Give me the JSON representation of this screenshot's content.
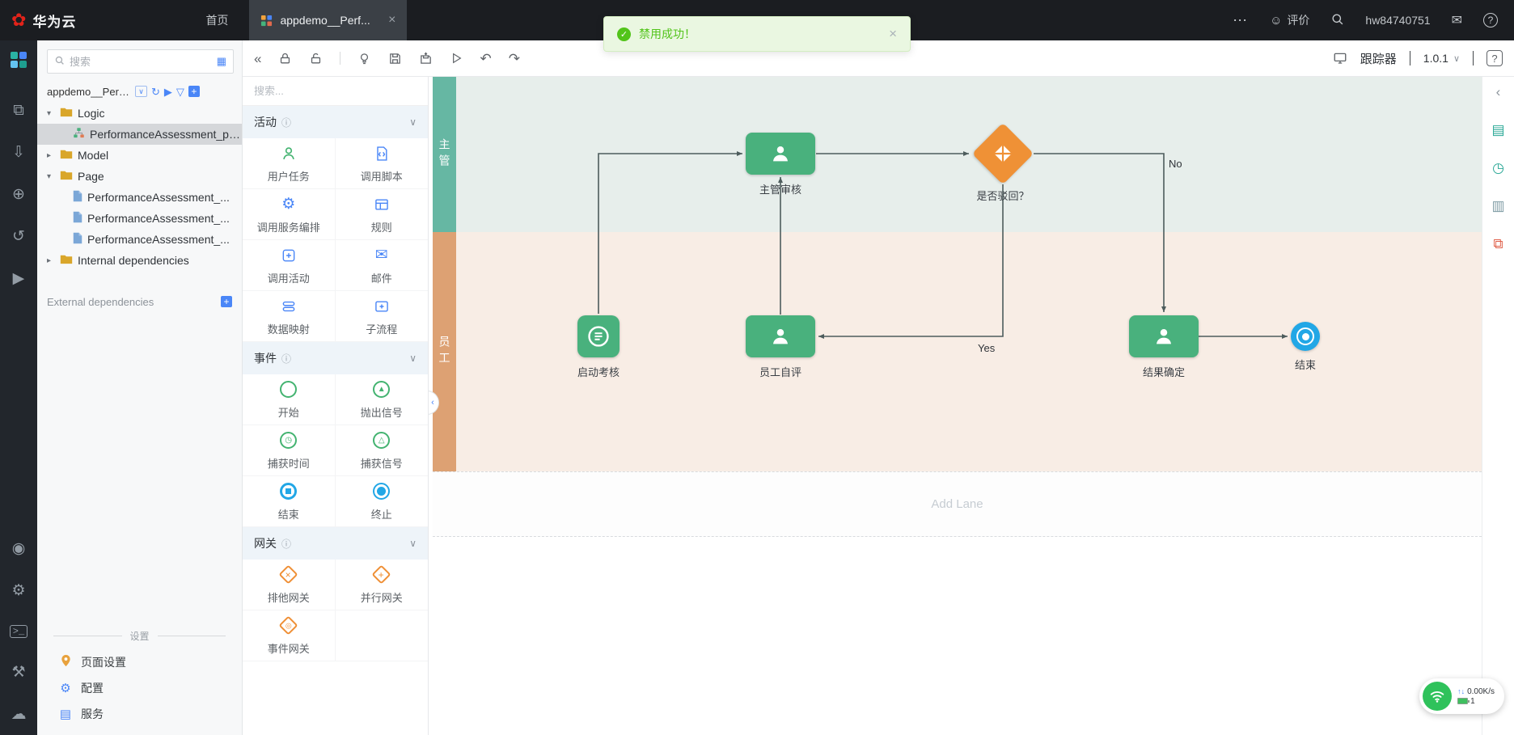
{
  "colors": {
    "node_green": "#49b17d",
    "gateway_orange": "#ef9136",
    "event_blue": "#22a7e6",
    "accent_blue": "#4a86f7",
    "toast_green": "#52c41a",
    "lane_supervisor": "#66b7a3",
    "lane_employee": "#dda173"
  },
  "topbar": {
    "brand": "华为云",
    "home_link": "首页",
    "tab_title": "appdemo__Perf...",
    "more": "⋯",
    "feedback": "评价",
    "username": "hw84740751"
  },
  "toast": {
    "message": "禁用成功！"
  },
  "explorer": {
    "search_placeholder": "搜索",
    "root_label": "appdemo__Perfo...",
    "tree": [
      {
        "label": "Logic"
      },
      {
        "label": "PerformanceAssessment_pe..."
      },
      {
        "label": "Model"
      },
      {
        "label": "Page"
      },
      {
        "label": "PerformanceAssessment_..."
      },
      {
        "label": "PerformanceAssessment_..."
      },
      {
        "label": "PerformanceAssessment_..."
      },
      {
        "label": "Internal dependencies"
      }
    ],
    "external_label": "External dependencies",
    "settings_title": "设置",
    "settings": [
      {
        "label": "页面设置"
      },
      {
        "label": "配置"
      },
      {
        "label": "服务"
      }
    ]
  },
  "palette": {
    "search_placeholder": "搜索...",
    "sections": [
      {
        "title": "活动",
        "items": [
          {
            "label": "用户任务"
          },
          {
            "label": "调用脚本"
          },
          {
            "label": "调用服务编排"
          },
          {
            "label": "规则"
          },
          {
            "label": "调用活动"
          },
          {
            "label": "邮件"
          },
          {
            "label": "数据映射"
          },
          {
            "label": "子流程"
          }
        ]
      },
      {
        "title": "事件",
        "items": [
          {
            "label": "开始"
          },
          {
            "label": "抛出信号"
          },
          {
            "label": "捕获时间"
          },
          {
            "label": "捕获信号"
          },
          {
            "label": "结束"
          },
          {
            "label": "终止"
          }
        ]
      },
      {
        "title": "网关",
        "items": [
          {
            "label": "排他网关"
          },
          {
            "label": "并行网关"
          },
          {
            "label": "事件网关"
          }
        ]
      }
    ]
  },
  "toolbar": {
    "tracker": "跟踪器",
    "version": "1.0.1"
  },
  "canvas": {
    "lanes": [
      {
        "label": "主管"
      },
      {
        "label": "员工"
      }
    ],
    "add_lane_label": "Add Lane",
    "nodes": [
      {
        "label": "启动考核"
      },
      {
        "label": "主管审核"
      },
      {
        "label": "是否驳回？"
      },
      {
        "label": "员工自评"
      },
      {
        "label": "结果确定"
      },
      {
        "label": "结束"
      }
    ],
    "edge_labels": {
      "no": "No",
      "yes": "Yes"
    }
  },
  "status_widget": {
    "speed": "0.00K/s",
    "count": "1"
  }
}
